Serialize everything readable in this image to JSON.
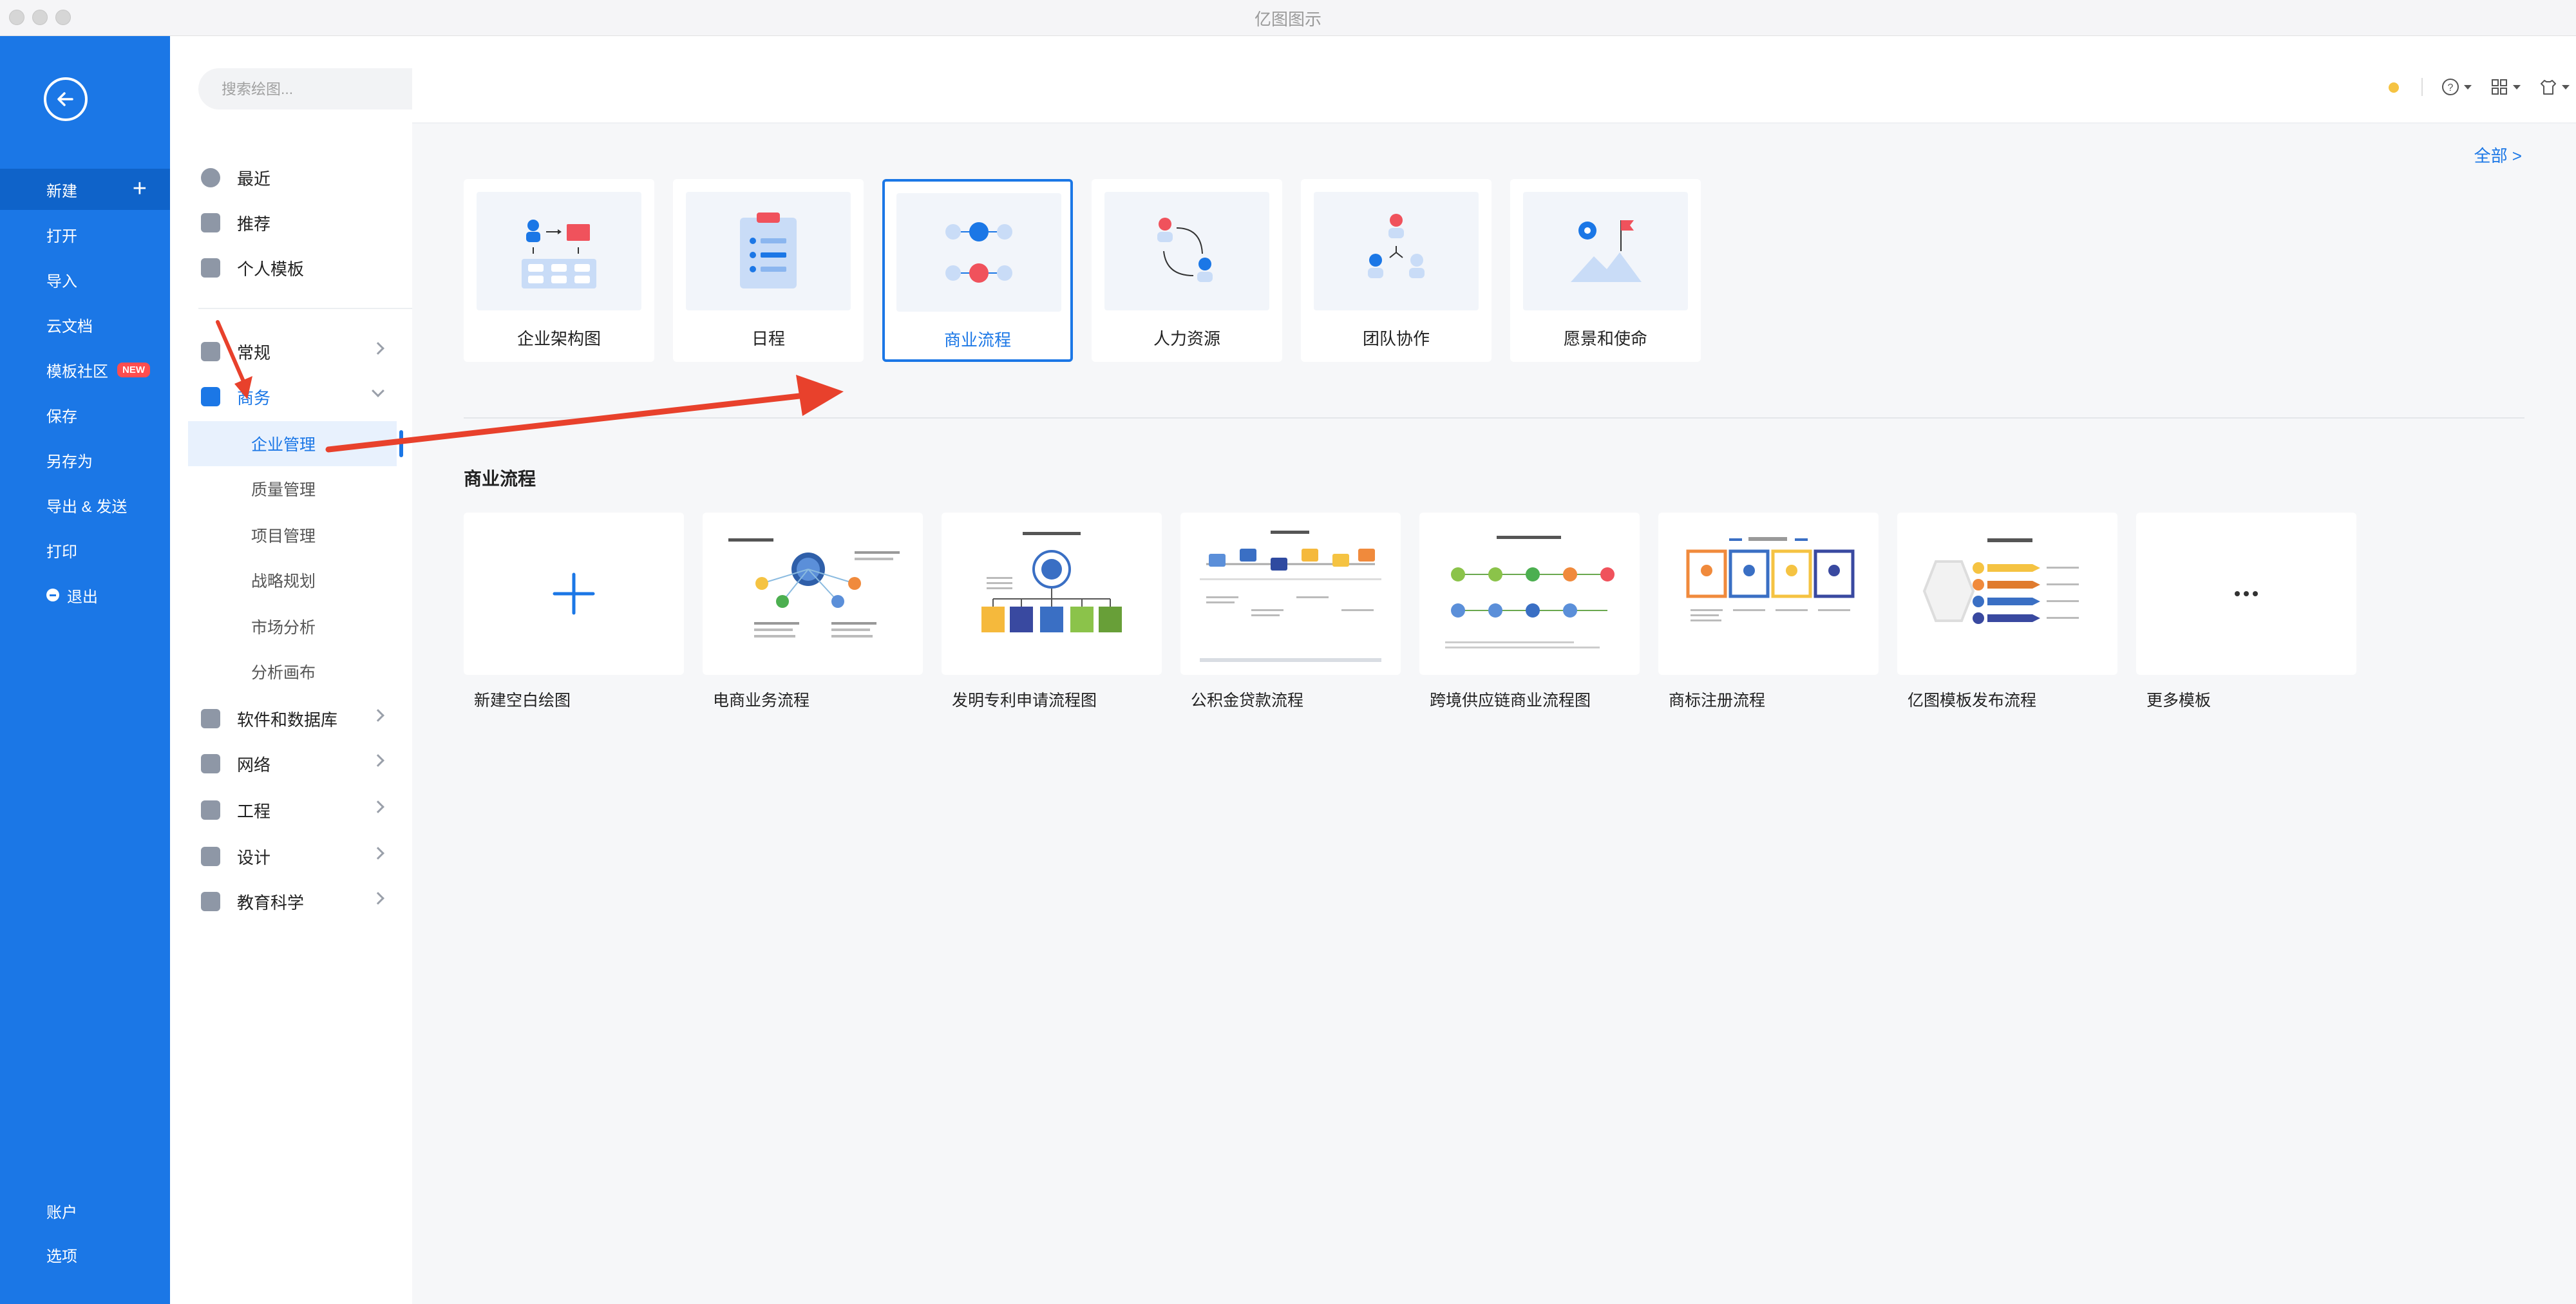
{
  "window": {
    "title": "亿图图示"
  },
  "left_nav": {
    "items": [
      {
        "label": "新建",
        "icon": "plus-icon"
      },
      {
        "label": "打开"
      },
      {
        "label": "导入"
      },
      {
        "label": "云文档"
      },
      {
        "label": "模板社区",
        "badge": "NEW"
      },
      {
        "label": "保存"
      },
      {
        "label": "另存为"
      },
      {
        "label": "导出 & 发送"
      },
      {
        "label": "打印"
      },
      {
        "label": "退出"
      }
    ],
    "bottom": [
      {
        "label": "账户"
      },
      {
        "label": "选项"
      }
    ]
  },
  "search": {
    "placeholder": "搜索绘图..."
  },
  "categories": {
    "top": [
      {
        "label": "最近"
      },
      {
        "label": "推荐"
      },
      {
        "label": "个人模板"
      }
    ],
    "groups": [
      {
        "label": "常规"
      },
      {
        "label": "商务"
      },
      {
        "label": "软件和数据库"
      },
      {
        "label": "网络"
      },
      {
        "label": "工程"
      },
      {
        "label": "设计"
      },
      {
        "label": "教育科学"
      }
    ],
    "business_sub": [
      {
        "label": "企业管理"
      },
      {
        "label": "质量管理"
      },
      {
        "label": "项目管理"
      },
      {
        "label": "战略规划"
      },
      {
        "label": "市场分析"
      },
      {
        "label": "分析画布"
      }
    ]
  },
  "main": {
    "all_link": "全部 >",
    "type_cards": [
      {
        "label": "企业架构图"
      },
      {
        "label": "日程"
      },
      {
        "label": "商业流程",
        "selected": true
      },
      {
        "label": "人力资源"
      },
      {
        "label": "团队协作"
      },
      {
        "label": "愿景和使命"
      }
    ],
    "section_title": "商业流程",
    "templates": [
      {
        "label": "新建空白绘图"
      },
      {
        "label": "电商业务流程"
      },
      {
        "label": "发明专利申请流程图"
      },
      {
        "label": "公积金贷款流程"
      },
      {
        "label": "跨境供应链商业流程图"
      },
      {
        "label": "商标注册流程"
      },
      {
        "label": "亿图模板发布流程"
      },
      {
        "label": "更多模板"
      }
    ]
  },
  "colors": {
    "accent": "#1b77e6",
    "sidebar": "#1b77e6",
    "badge": "#ff4d4f",
    "annotation_arrow": "#e8412c"
  }
}
